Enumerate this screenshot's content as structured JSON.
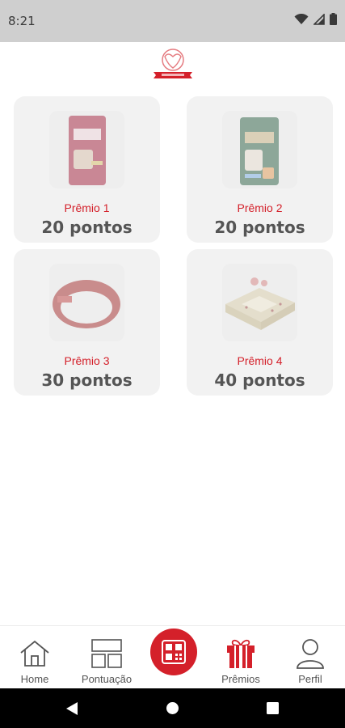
{
  "status_bar": {
    "time": "8:21",
    "icons": [
      "wifi-icon",
      "signal-icon",
      "battery-icon"
    ]
  },
  "header": {
    "logo": "brand-logo"
  },
  "prizes": [
    {
      "label": "Prêmio 1",
      "points": "20 pontos",
      "image": "cat-food-bag"
    },
    {
      "label": "Prêmio 2",
      "points": "20 pontos",
      "image": "dog-food-bag"
    },
    {
      "label": "Prêmio 3",
      "points": "30 pontos",
      "image": "pet-collar"
    },
    {
      "label": "Prêmio 4",
      "points": "40 pontos",
      "image": "pet-bed"
    }
  ],
  "bottom_nav": {
    "items": [
      {
        "label": "Home",
        "icon": "home-icon"
      },
      {
        "label": "Pontuação",
        "icon": "dashboard-icon"
      },
      {
        "label": "",
        "icon": "qr-code-icon"
      },
      {
        "label": "Prêmios",
        "icon": "gift-icon",
        "active": true
      },
      {
        "label": "Perfil",
        "icon": "user-icon"
      }
    ]
  },
  "colors": {
    "accent": "#d4202a",
    "card_bg": "#f2f2f2",
    "text_gray": "#555555",
    "status_bar": "#cfcfcf"
  }
}
